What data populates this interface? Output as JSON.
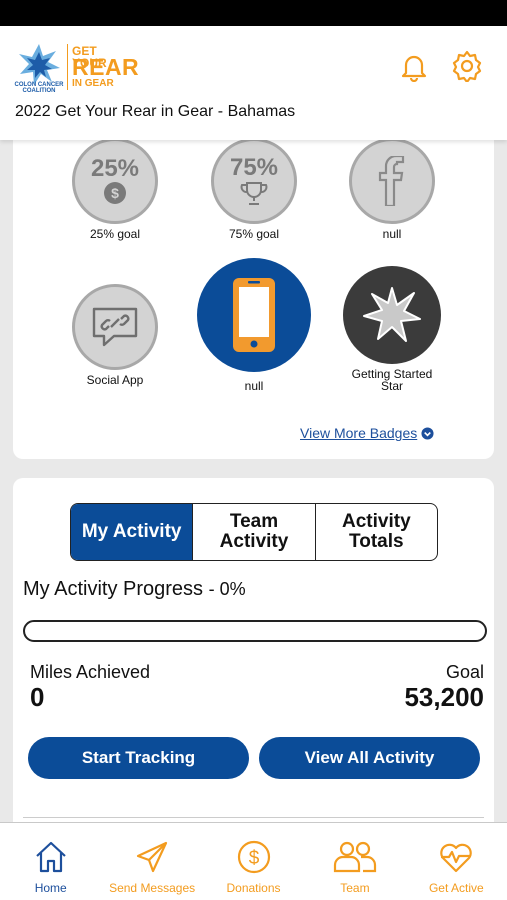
{
  "header": {
    "logo": {
      "org": "COLON CANCER COALITION",
      "line1": "GET YOUR",
      "line2": "REAR",
      "line3": "IN GEAR"
    },
    "event_title": "2022 Get Your Rear in Gear - Bahamas",
    "icons": [
      "bell-icon",
      "gear-icon"
    ]
  },
  "badges": {
    "items": [
      {
        "label": "25% goal",
        "text": "25%",
        "icon": "dollar-coin-icon"
      },
      {
        "label": "75% goal",
        "text": "75%",
        "icon": "trophy-icon"
      },
      {
        "label": "null",
        "icon": "facebook-icon"
      },
      {
        "label": "Social App",
        "icon": "chat-link-icon"
      },
      {
        "label": "null",
        "icon": "smartphone-icon"
      },
      {
        "label": "Getting Started Star",
        "icon": "star-burst-icon"
      }
    ],
    "view_more": "View More Badges"
  },
  "activity": {
    "tabs": [
      "My Activity",
      "Team Activity",
      "Activity Totals"
    ],
    "selected_tab": "My Activity",
    "progress_title": "My Activity Progress",
    "progress_pct": "- 0%",
    "progress_value": 0,
    "miles_label": "Miles Achieved",
    "miles_value": "0",
    "goal_label": "Goal",
    "goal_value": "53,200",
    "start_button": "Start Tracking",
    "view_button": "View All Activity"
  },
  "tabbar": {
    "items": [
      {
        "label": "Home",
        "icon": "home-icon",
        "active": true
      },
      {
        "label": "Send Messages",
        "icon": "paper-plane-icon"
      },
      {
        "label": "Donations",
        "icon": "dollar-icon"
      },
      {
        "label": "Team",
        "icon": "team-icon"
      },
      {
        "label": "Get Active",
        "icon": "heart-pulse-icon"
      }
    ]
  },
  "colors": {
    "brand_blue": "#0b4c98",
    "brand_orange": "#f39c1f",
    "badge_grey": "#d3d3d3"
  }
}
